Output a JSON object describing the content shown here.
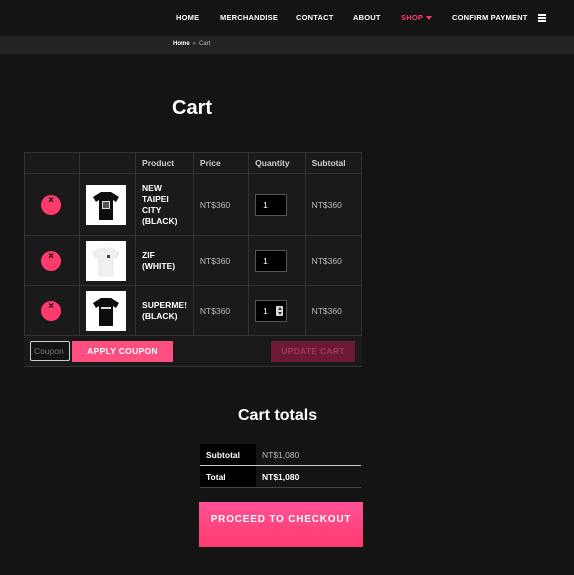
{
  "nav": {
    "items": [
      {
        "label": "HOME"
      },
      {
        "label": "MERCHANDISE"
      },
      {
        "label": "CONTACT"
      },
      {
        "label": "ABOUT"
      },
      {
        "label": "SHOP"
      },
      {
        "label": "CONFIRM PAYMENT"
      }
    ],
    "active_item": "SHOP",
    "menu_icon": "hamburger-icon"
  },
  "breadcrumb": {
    "home": "Home",
    "separator": "»",
    "current": "Cart"
  },
  "page": {
    "title": "Cart"
  },
  "cart": {
    "headers": {
      "product": "Product",
      "price": "Price",
      "quantity": "Quantity",
      "subtotal": "Subtotal"
    },
    "items": [
      {
        "name": "NEW TAIPEI CITY (BLACK)",
        "price": "NT$360",
        "quantity": "1",
        "subtotal": "NT$360",
        "shirt_color": "#0d0d0d"
      },
      {
        "name": "ZIF (WHITE)",
        "price": "NT$360",
        "quantity": "1",
        "subtotal": "NT$360",
        "shirt_color": "#f4f4f4"
      },
      {
        "name": "SUPERME! (BLACK)",
        "price": "NT$360",
        "quantity": "1",
        "subtotal": "NT$360",
        "shirt_color": "#0d0d0d"
      }
    ],
    "remove_symbol": "×",
    "coupon_placeholder": "Coupon",
    "apply_coupon_label": "APPLY COUPON",
    "update_cart_label": "UPDATE CART"
  },
  "totals": {
    "title": "Cart totals",
    "subtotal_label": "Subtotal",
    "subtotal_value": "NT$1,080",
    "total_label": "Total",
    "total_value": "NT$1,080",
    "checkout_label": "PROCEED TO CHECKOUT"
  },
  "colors": {
    "accent": "#ff3b6e",
    "background": "#141414",
    "update_disabled": "#6c1a34"
  }
}
